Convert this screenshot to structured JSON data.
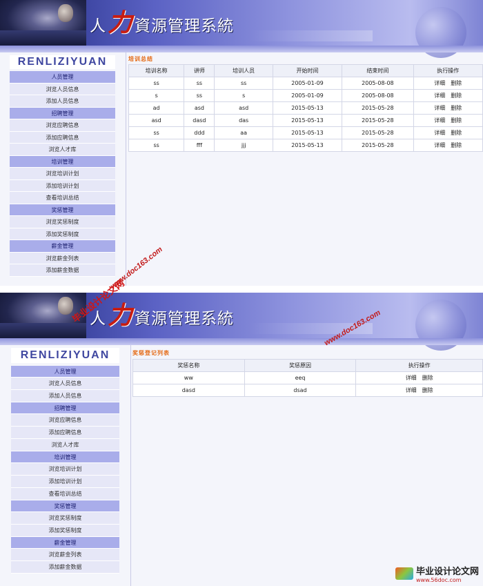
{
  "banner": {
    "title_big": "力",
    "title_lead": "人",
    "title_rest": "資源管理系統"
  },
  "logo": "RENLIZIYUAN",
  "menu": [
    {
      "section": "人员管理",
      "items": [
        "浏览人员信息",
        "添加人员信息"
      ]
    },
    {
      "section": "招聘管理",
      "items": [
        "浏览应聘信息",
        "添加应聘信息",
        "浏览人才库"
      ]
    },
    {
      "section": "培训管理",
      "items": [
        "浏览培训计划",
        "添加培训计划",
        "查看培训总结"
      ]
    },
    {
      "section": "奖惩管理",
      "items": [
        "浏览奖惩制度",
        "添加奖惩制度"
      ]
    },
    {
      "section": "薪金管理",
      "items": [
        "浏览薪金列表",
        "添加薪金数据"
      ]
    }
  ],
  "menu2_rewards_item1": "浏览奖惩制度",
  "screen1": {
    "title": "培训总结",
    "columns": [
      "培训名称",
      "讲师",
      "培训人员",
      "开始时间",
      "结束时间",
      "执行操作"
    ],
    "rows": [
      [
        "ss",
        "ss",
        "ss",
        "2005-01-09",
        "2005-08-08"
      ],
      [
        "s",
        "ss",
        "s",
        "2005-01-09",
        "2005-08-08"
      ],
      [
        "ad",
        "asd",
        "asd",
        "2015-05-13",
        "2015-05-28"
      ],
      [
        "asd",
        "dasd",
        "das",
        "2015-05-13",
        "2015-05-28"
      ],
      [
        "ss",
        "ddd",
        "aa",
        "2015-05-13",
        "2015-05-28"
      ],
      [
        "ss",
        "fff",
        "jjj",
        "2015-05-13",
        "2015-05-28"
      ]
    ],
    "detail_label": "详细",
    "delete_label": "删除"
  },
  "screen2": {
    "title": "奖惩登记列表",
    "columns": [
      "奖惩名称",
      "奖惩原因",
      "执行操作"
    ],
    "rows": [
      [
        "ww",
        "eeq"
      ],
      [
        "dasd",
        "dsad"
      ]
    ],
    "detail_label": "详细",
    "delete_label": "删除"
  },
  "watermarks": {
    "site": "www.doc163.com",
    "site2": "www.doc163.com",
    "cn": "毕业设计论文网",
    "footer_cn": "毕业设计论文网",
    "footer_url": "www.56doc.com"
  }
}
